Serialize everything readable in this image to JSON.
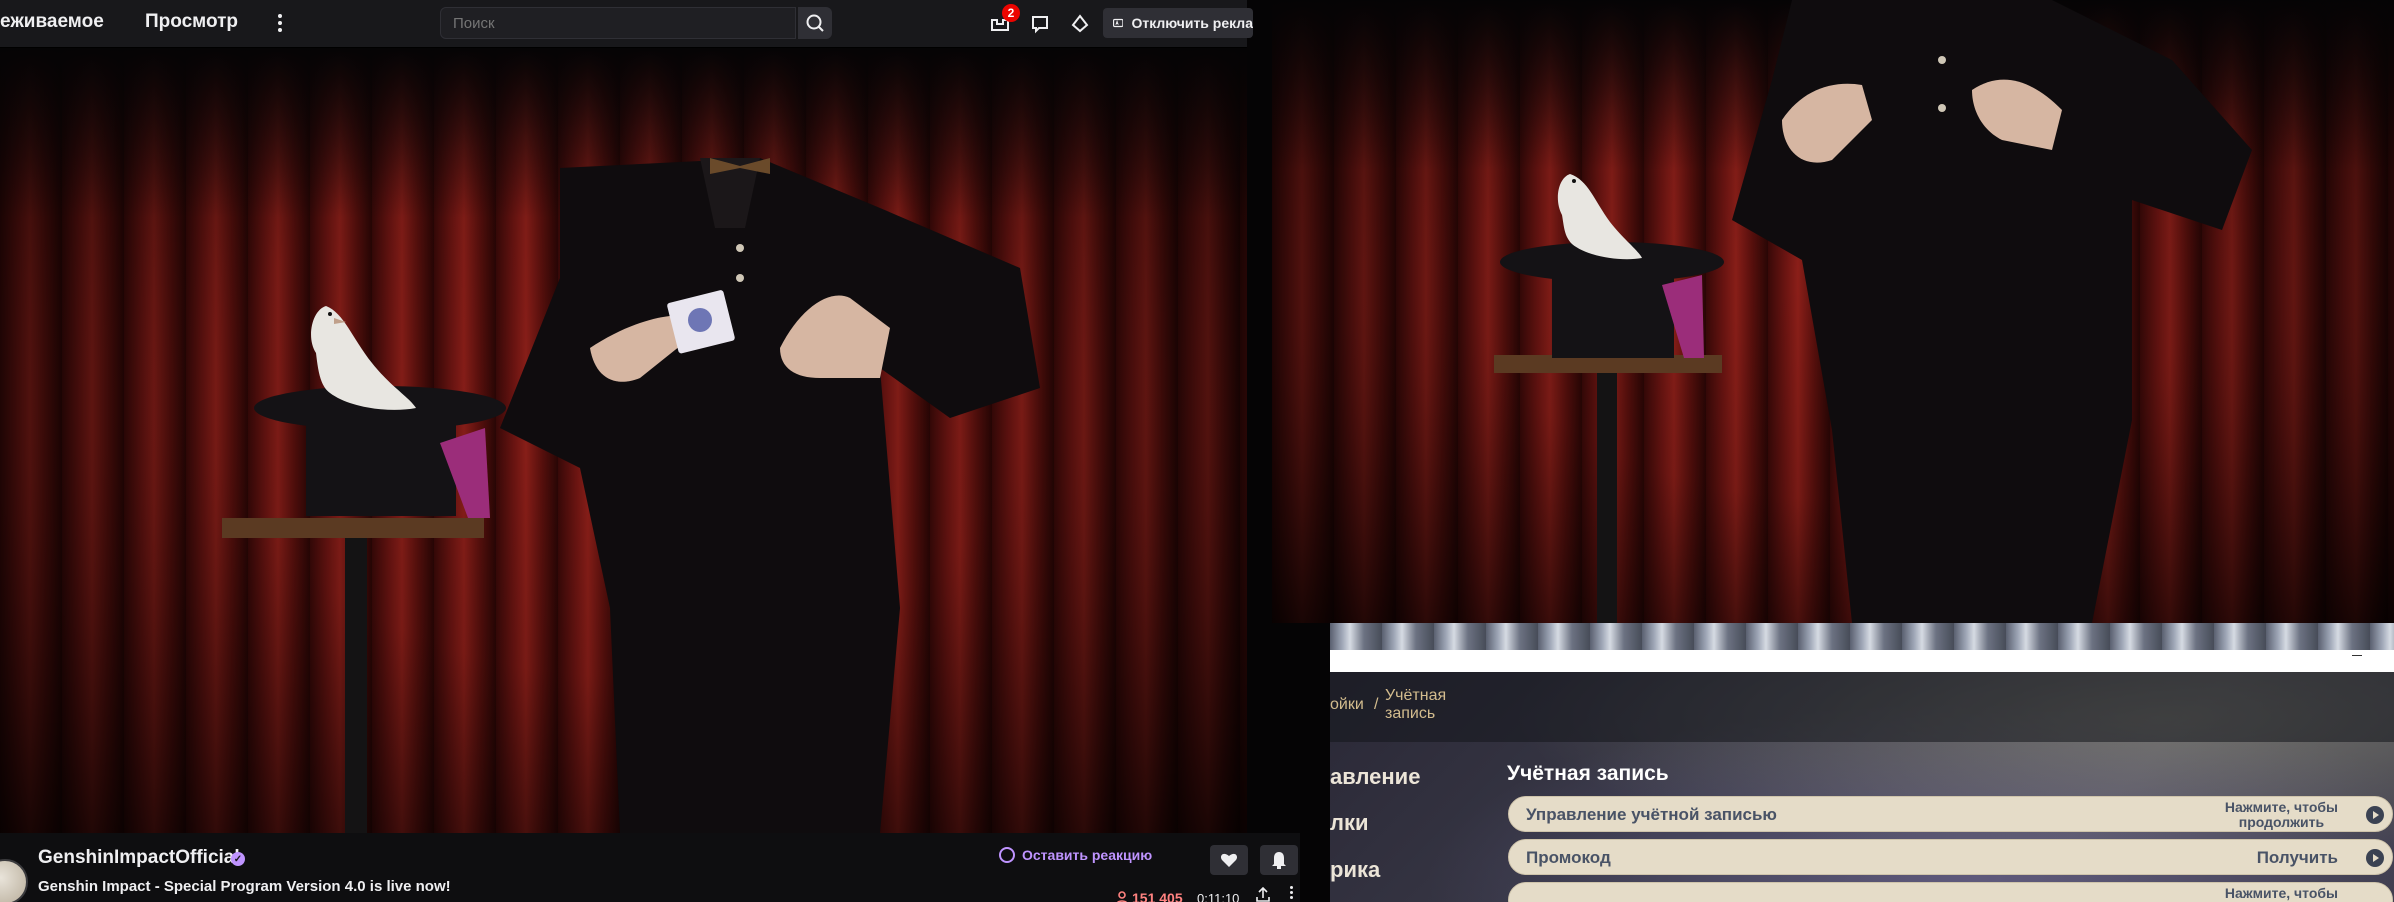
{
  "twitch": {
    "nav": {
      "following": "еживаемое",
      "browse": "Просмотр"
    },
    "search": {
      "placeholder": "Поиск"
    },
    "inbox_badge": "2",
    "ad_free_label": "Отключить рекла",
    "stream": {
      "channel": "GenshinImpactOfficial",
      "title": "Genshin Impact - Special Program Version 4.0 is live now!",
      "react_label": "Оставить реакцию",
      "viewers": "151 405",
      "uptime": "0:11:10"
    },
    "colors": {
      "accent": "#bf94ff",
      "live_red": "#ff8280",
      "topbar": "#18181b"
    }
  },
  "genshin": {
    "breadcrumb": {
      "prev": "ойки",
      "separator": "/",
      "current_line1": "Учётная",
      "current_line2": "запись"
    },
    "sidebar": [
      "авление",
      "лки",
      "рика"
    ],
    "heading": "Учётная запись",
    "rows": [
      {
        "label": "Управление учётной записью",
        "action_line1": "Нажмите, чтобы",
        "action_line2": "продолжить"
      },
      {
        "label": "Промокод",
        "action_line1": "Получить",
        "action_line2": ""
      },
      {
        "label": "",
        "action_line1": "Нажмите, чтобы",
        "action_line2": ""
      }
    ]
  }
}
